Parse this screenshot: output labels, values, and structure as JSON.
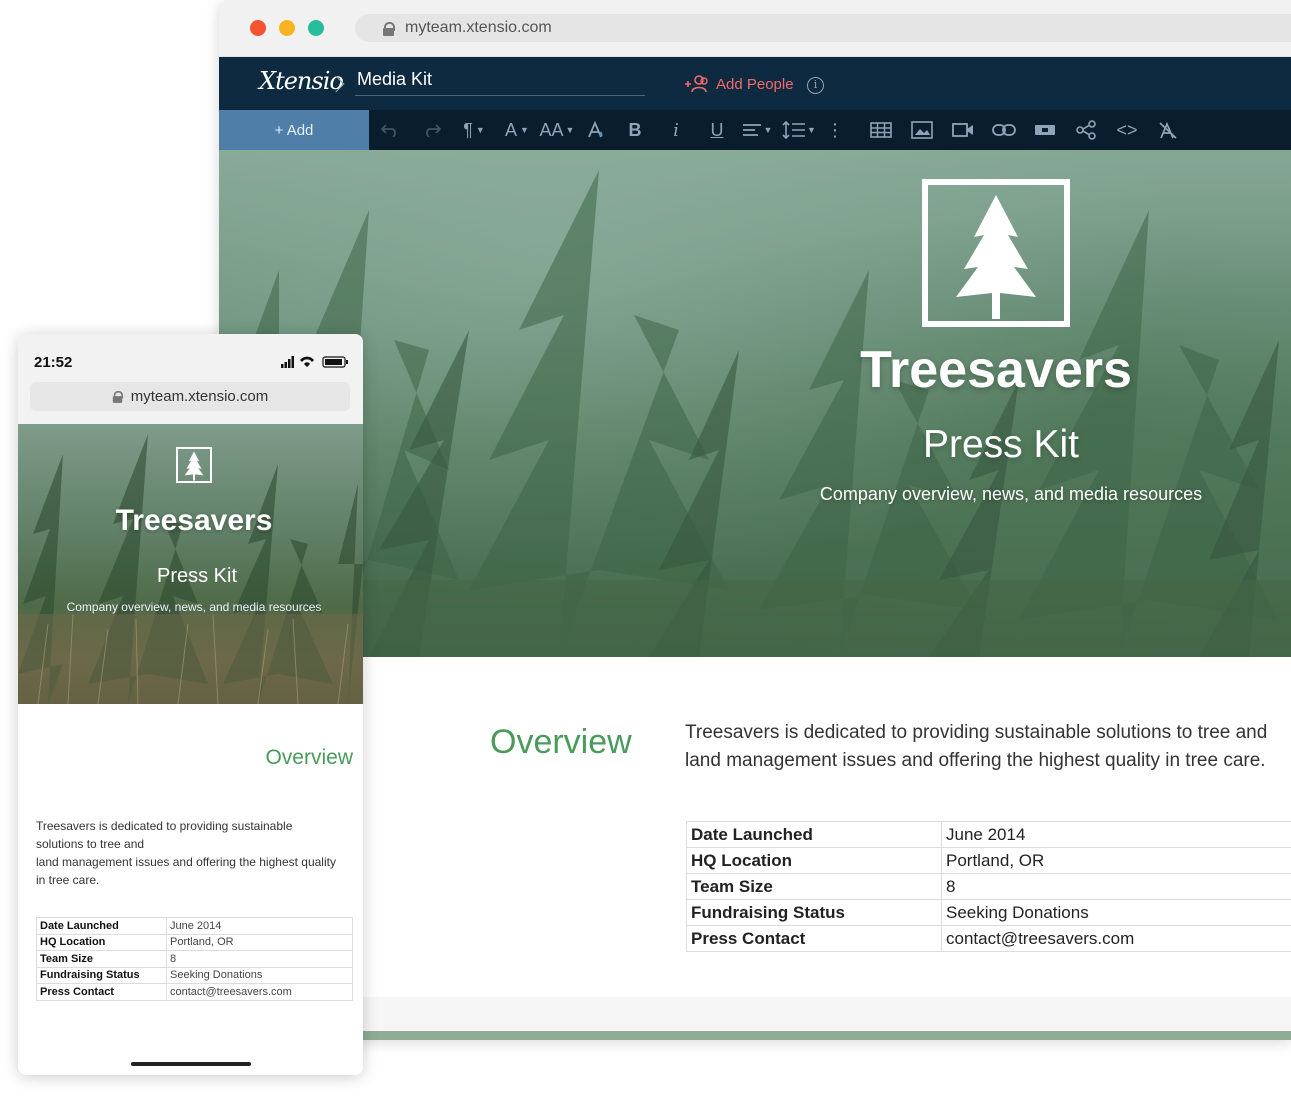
{
  "desktop": {
    "url": "myteam.xtensio.com",
    "logo": "Xtensio",
    "doc_title": "Media Kit",
    "add_people": "Add People",
    "info": "i",
    "add_button": "+ Add",
    "toolbar": {
      "paragraph": "¶",
      "font": "A",
      "font_size": "AA",
      "bold": "B",
      "italic": "i",
      "underline": "U",
      "more": "⋮",
      "code": "<>"
    },
    "hero": {
      "title": "Treesavers",
      "subtitle": "Press Kit",
      "tagline": "Company overview, news, and media resources"
    },
    "overview": {
      "heading": "Overview",
      "lines": [
        "Treesavers is dedicated to providing sustainable solutions to tree and",
        "land management issues and offering the highest quality in tree care."
      ]
    },
    "facts": [
      {
        "label": "Date Launched",
        "value": "June 2014"
      },
      {
        "label": "HQ Location",
        "value": "Portland, OR"
      },
      {
        "label": "Team Size",
        "value": "8"
      },
      {
        "label": "Fundraising Status",
        "value": "Seeking Donations"
      },
      {
        "label": "Press Contact",
        "value": "contact@treesavers.com"
      }
    ]
  },
  "mobile": {
    "time": "21:52",
    "url": "myteam.xtensio.com",
    "hero": {
      "title": "Treesavers",
      "subtitle": "Press Kit",
      "tagline": "Company overview, news, and media resources"
    },
    "overview": {
      "heading": "Overview",
      "lines": [
        "Treesavers is dedicated to providing sustainable",
        "solutions to tree and",
        "land management issues and offering the highest quality",
        "in tree care."
      ]
    },
    "facts": [
      {
        "label": "Date Launched",
        "value": "June 2014"
      },
      {
        "label": "HQ Location",
        "value": "Portland, OR"
      },
      {
        "label": "Team Size",
        "value": "8"
      },
      {
        "label": "Fundraising Status",
        "value": "Seeking Donations"
      },
      {
        "label": "Press Contact",
        "value": "contact@treesavers.com"
      }
    ]
  },
  "colors": {
    "app_bar": "#0e2a40",
    "toolbar": "#0a1d2c",
    "add_button": "#4f7ea8",
    "accent_green": "#4a9a5a",
    "add_people": "#f26b6b"
  }
}
